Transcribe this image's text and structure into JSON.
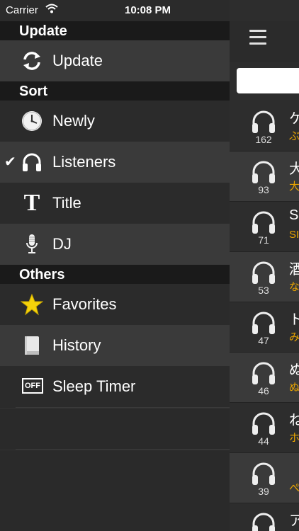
{
  "status": {
    "carrier": "Carrier",
    "time": "10:08 PM"
  },
  "menu": {
    "sections": {
      "update": "Update",
      "sort": "Sort",
      "others": "Others"
    },
    "items": {
      "update": "Update",
      "newly": "Newly",
      "listeners": "Listeners",
      "title": "Title",
      "dj": "DJ",
      "favorites": "Favorites",
      "history": "History",
      "sleep_timer": "Sleep Timer"
    },
    "check_mark": "✔",
    "off_badge": "OFF",
    "title_glyph": "T"
  },
  "list": [
    {
      "count": "162",
      "t1": "ケ",
      "t2": "ぶ"
    },
    {
      "count": "93",
      "t1": "大",
      "t2": "大"
    },
    {
      "count": "71",
      "t1": "S",
      "t2": "SI"
    },
    {
      "count": "53",
      "t1": "酒",
      "t2": "な"
    },
    {
      "count": "47",
      "t1": "ト",
      "t2": "み"
    },
    {
      "count": "46",
      "t1": "ぬ",
      "t2": "ぬ"
    },
    {
      "count": "44",
      "t1": "ね",
      "t2": "ホ"
    },
    {
      "count": "39",
      "t1": "",
      "t2": "ぺ"
    },
    {
      "count": "",
      "t1": "ア",
      "t2": ""
    }
  ],
  "colors": {
    "accent": "#e9a400",
    "star": "#f5d20a"
  }
}
